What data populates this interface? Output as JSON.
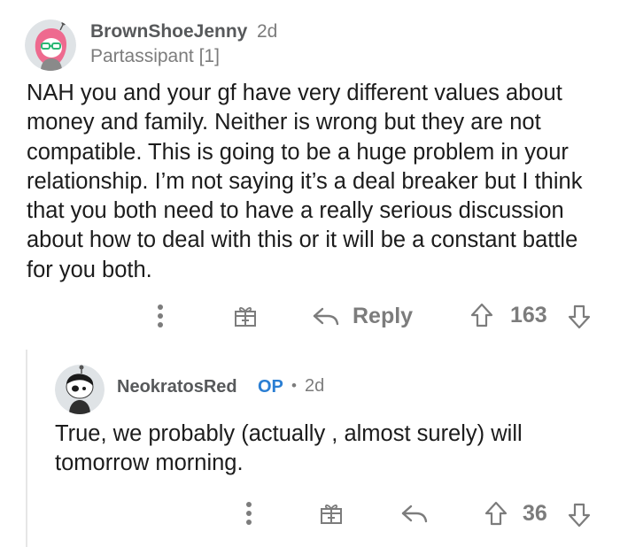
{
  "parent": {
    "username": "BrownShoeJenny",
    "age": "2d",
    "flair": "Partassipant [1]",
    "body": "NAH you and your gf have very different values about money and family. Neither is wrong but they are not compatible. This is going to be a huge problem in your relationship. I’m not saying it’s a deal breaker but I think that you both need to have a really serious discussion about how to deal with this or it will be a constant battle for you both.",
    "reply_label": "Reply",
    "score": "163"
  },
  "reply": {
    "username": "NeokratosRed",
    "op_badge": "OP",
    "separator": "•",
    "age": "2d",
    "body": "True, we probably (actually , almost surely) will tomorrow morning.",
    "score": "36"
  },
  "colors": {
    "text": "#1c1c1c",
    "muted": "#7c7c7c",
    "op": "#2a7ed3",
    "thread_line": "#e6e6e6"
  },
  "icons": [
    "more-options-icon",
    "award-icon",
    "reply-arrow-icon",
    "upvote-icon",
    "downvote-icon"
  ]
}
